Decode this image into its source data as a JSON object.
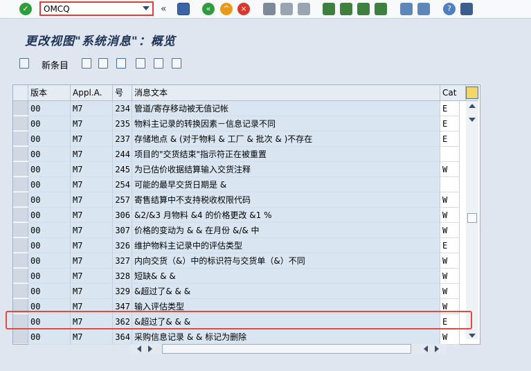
{
  "toolbar": {
    "command_value": "OMCQ",
    "icons": [
      "ok-icon",
      "back-icon",
      "exit-icon",
      "cancel-icon",
      "print-icon",
      "find-icon",
      "find-next-icon",
      "first-page-icon",
      "prev-page-icon",
      "next-page-icon",
      "last-page-icon",
      "new-session-icon",
      "shortcut-icon",
      "help-icon",
      "layout-icon"
    ]
  },
  "title": "更改视图\"系统消息\"：概览",
  "app_toolbar": {
    "new_entries_label": "新条目"
  },
  "table": {
    "columns": [
      "版本",
      "Appl.A.",
      "号",
      "消息文本",
      "Cat"
    ],
    "rows": [
      {
        "ver": "00",
        "app": "M7",
        "num": "234",
        "text": "管道/寄存移动被无值记帐",
        "cat": "E"
      },
      {
        "ver": "00",
        "app": "M7",
        "num": "235",
        "text": "物料主记录的转换因素－信息记录不同",
        "cat": "E"
      },
      {
        "ver": "00",
        "app": "M7",
        "num": "237",
        "text": "存储地点 & (对于物料 & 工厂 & 批次 & )不存在",
        "cat": "E"
      },
      {
        "ver": "00",
        "app": "M7",
        "num": "244",
        "text": "项目的\"交货结束\"指示符正在被重置",
        "cat": ""
      },
      {
        "ver": "00",
        "app": "M7",
        "num": "245",
        "text": "为已估价收据结算输入交货注释",
        "cat": "W"
      },
      {
        "ver": "00",
        "app": "M7",
        "num": "254",
        "text": "可能的最早交货日期是 &",
        "cat": ""
      },
      {
        "ver": "00",
        "app": "M7",
        "num": "257",
        "text": "寄售结算中不支持税收权限代码",
        "cat": "W"
      },
      {
        "ver": "00",
        "app": "M7",
        "num": "306",
        "text": "&2/&3 月物料 &4 的价格更改 &1 %",
        "cat": "W"
      },
      {
        "ver": "00",
        "app": "M7",
        "num": "307",
        "text": "价格的变动为 & & 在月份 &/& 中",
        "cat": "W"
      },
      {
        "ver": "00",
        "app": "M7",
        "num": "326",
        "text": "维护物料主记录中的评估类型",
        "cat": "E"
      },
      {
        "ver": "00",
        "app": "M7",
        "num": "327",
        "text": "内向交货（&）中的标识符与交货单（&）不同",
        "cat": "W"
      },
      {
        "ver": "00",
        "app": "M7",
        "num": "328",
        "text": "短缺& & &",
        "cat": "W"
      },
      {
        "ver": "00",
        "app": "M7",
        "num": "329",
        "text": "&超过了& & &",
        "cat": "W"
      },
      {
        "ver": "00",
        "app": "M7",
        "num": "347",
        "text": "输入评估类型",
        "cat": "W"
      },
      {
        "ver": "00",
        "app": "M7",
        "num": "362",
        "text": "&超过了& & &",
        "cat": "E"
      },
      {
        "ver": "00",
        "app": "M7",
        "num": "364",
        "text": "采购信息记录 & & 标记为删除",
        "cat": "W"
      }
    ]
  }
}
